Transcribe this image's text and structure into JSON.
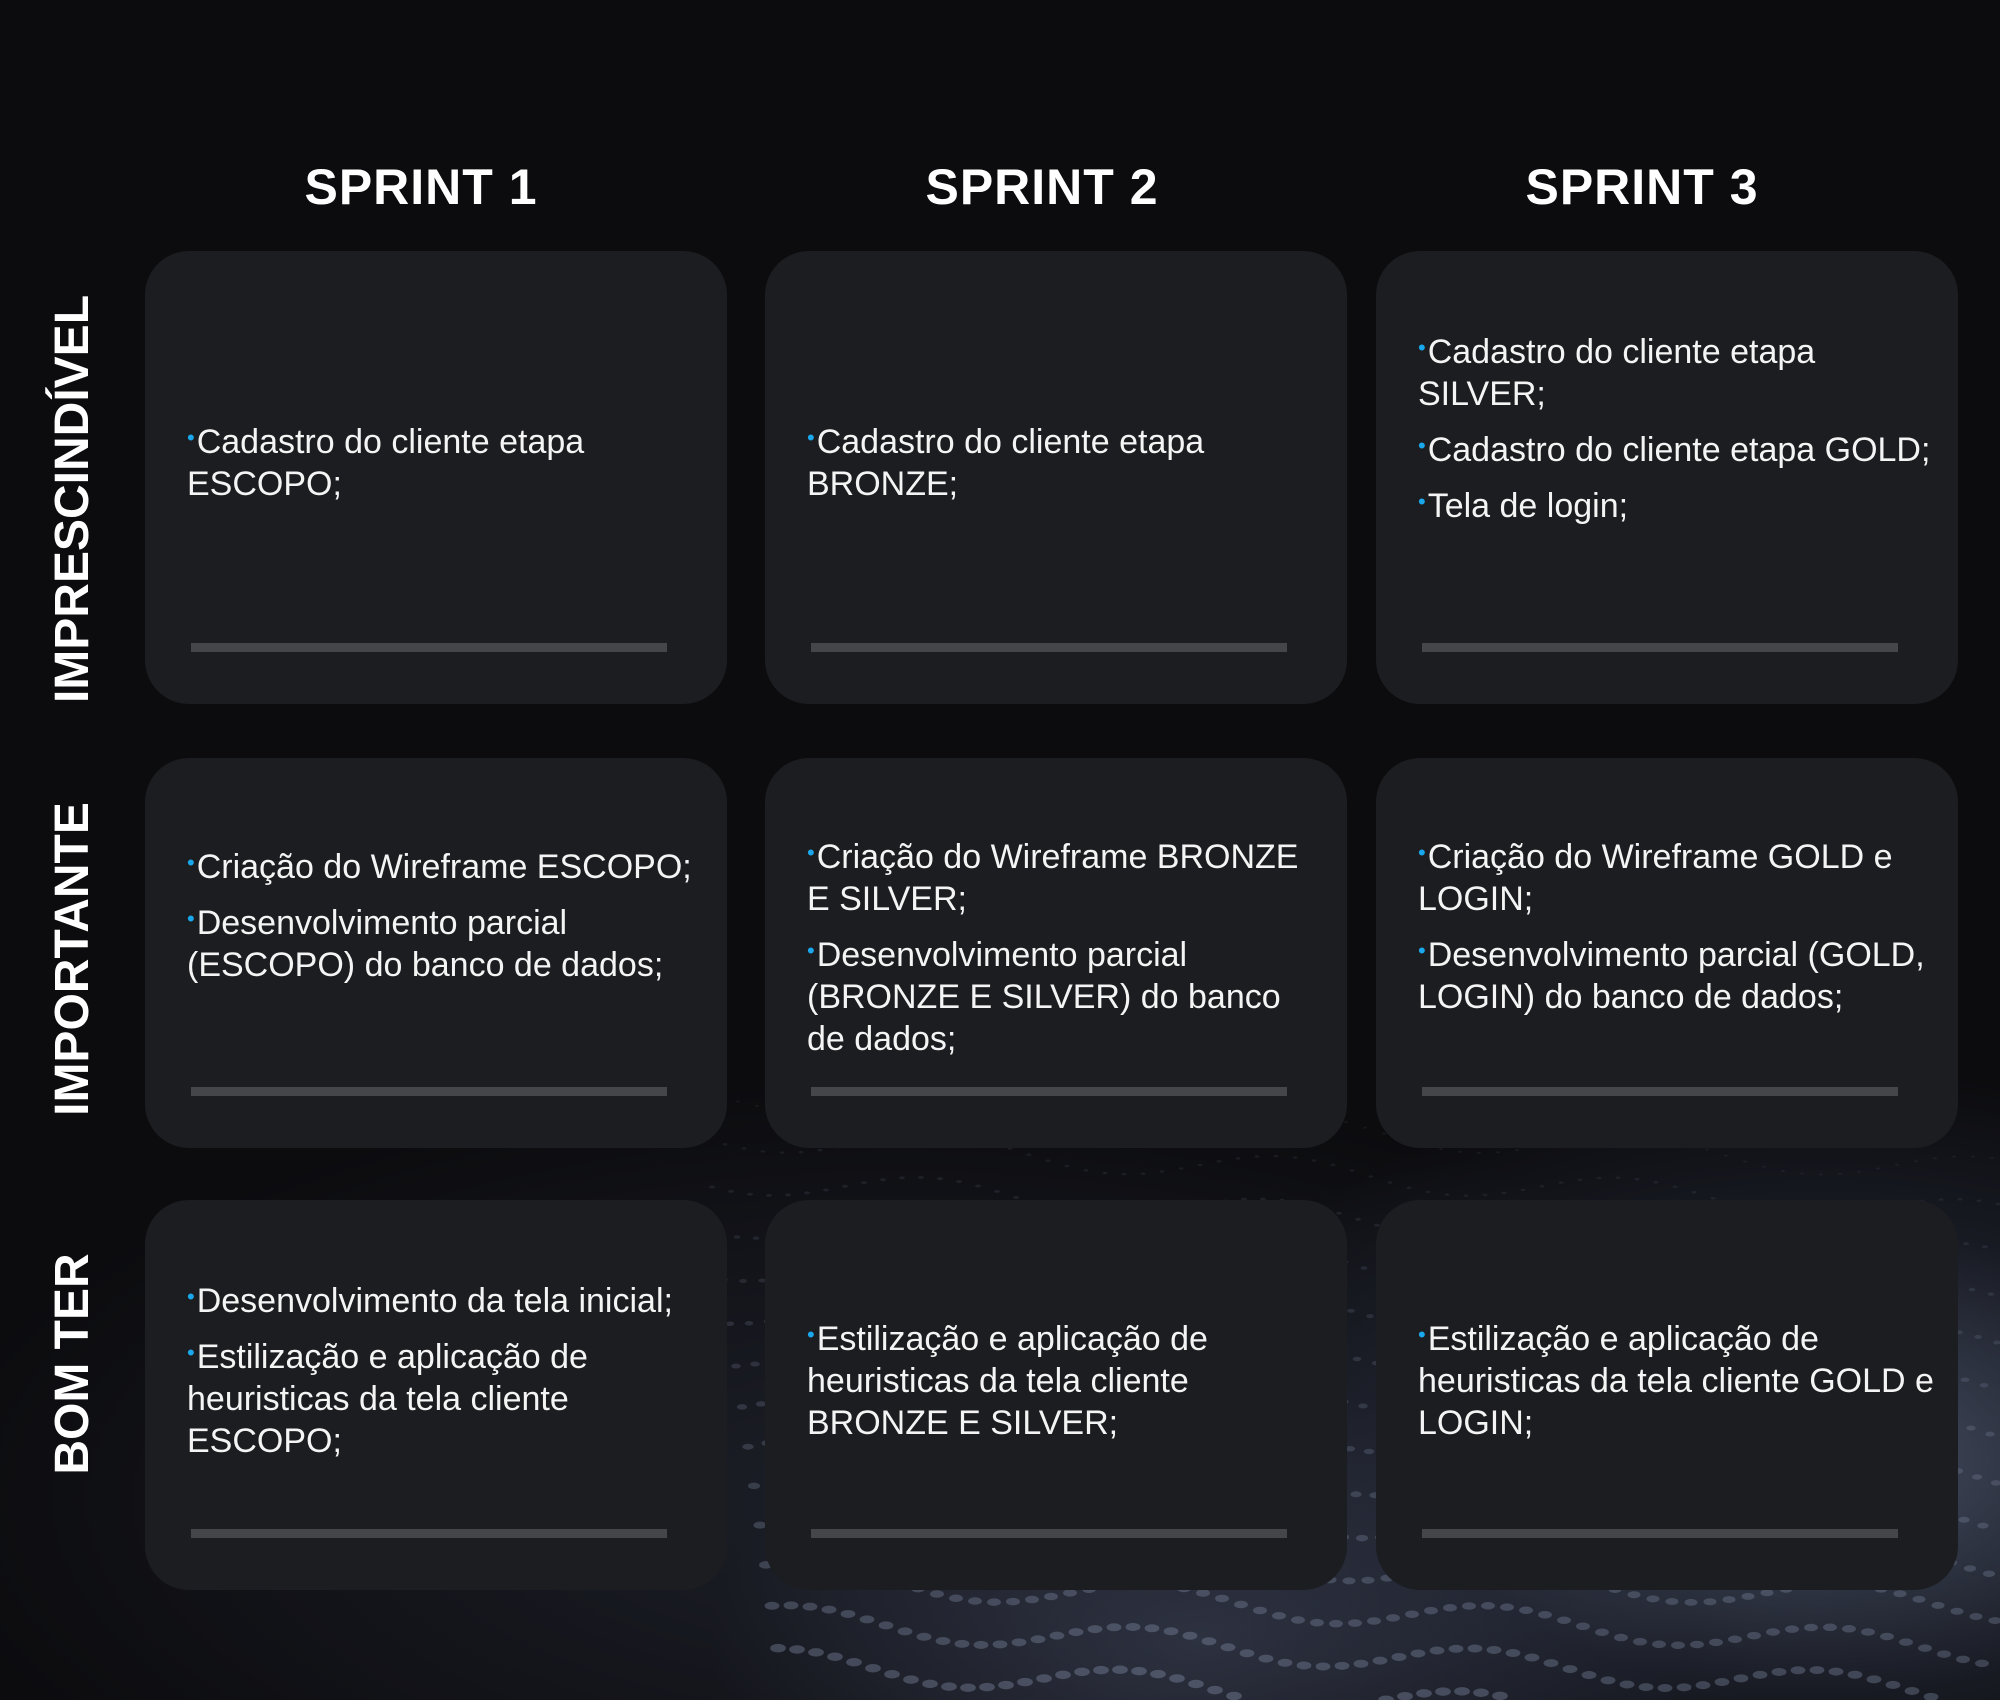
{
  "columns": [
    "SPRINT 1",
    "SPRINT 2",
    "SPRINT 3"
  ],
  "rows": [
    "IMPRESCINDÍVEL",
    "IMPORTANTE",
    "BOM TER"
  ],
  "colors": {
    "background": "#0c0c0f",
    "card": "#1c1d20",
    "bullet": "#1aa7ec",
    "bar": "#45464a",
    "text": "#f4f4f4"
  },
  "cells": [
    [
      {
        "items": [
          "Cadastro do cliente etapa ESCOPO;"
        ]
      },
      {
        "items": [
          "Cadastro do cliente etapa BRONZE;"
        ]
      },
      {
        "items": [
          "Cadastro do cliente etapa SILVER;",
          "Cadastro do cliente etapa GOLD;",
          "Tela de login;"
        ]
      }
    ],
    [
      {
        "items": [
          "Criação do Wireframe ESCOPO;",
          "Desenvolvimento parcial (ESCOPO) do banco de dados;"
        ]
      },
      {
        "items": [
          "Criação do Wireframe BRONZE E SILVER;",
          "Desenvolvimento parcial (BRONZE E SILVER) do banco de dados;"
        ]
      },
      {
        "items": [
          "Criação do Wireframe GOLD e LOGIN;",
          "Desenvolvimento parcial (GOLD, LOGIN) do banco de dados;"
        ]
      }
    ],
    [
      {
        "items": [
          "Desenvolvimento da tela inicial;",
          "Estilização e aplicação de heuristicas da tela cliente ESCOPO;"
        ]
      },
      {
        "items": [
          "Estilização e aplicação de heuristicas da tela cliente BRONZE E SILVER;"
        ]
      },
      {
        "items": [
          "Estilização e aplicação de heuristicas da tela cliente GOLD e LOGIN;"
        ]
      }
    ]
  ]
}
